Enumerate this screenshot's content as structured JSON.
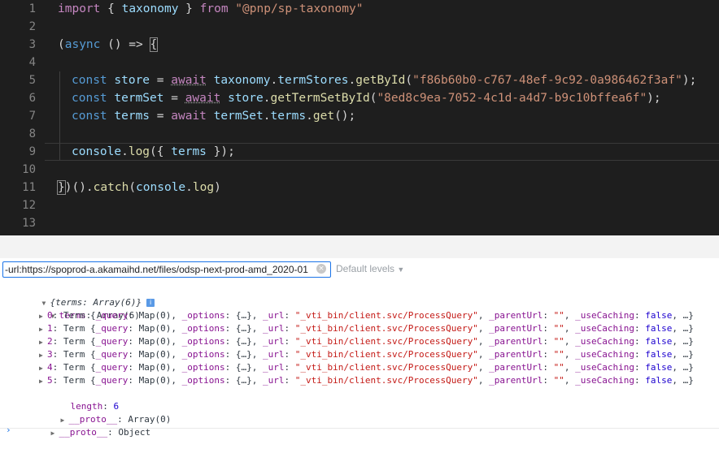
{
  "editor": {
    "line_numbers": [
      "1",
      "2",
      "3",
      "4",
      "5",
      "6",
      "7",
      "8",
      "9",
      "10",
      "11",
      "12",
      "13"
    ],
    "l1": {
      "import": "import",
      "brace_open": " { ",
      "name": "taxonomy",
      "brace_close": " } ",
      "from": "from",
      "space": " ",
      "module": "\"@pnp/sp-taxonomy\""
    },
    "l3": {
      "open": "(",
      "async": "async",
      "rest": " () => ",
      "brace": "{"
    },
    "l5": {
      "const": "const",
      "var": " store",
      "eq": " = ",
      "await": "await",
      "obj": " taxonomy",
      "dot1": ".",
      "prop": "termStores",
      "dot2": ".",
      "fn": "getById",
      "p1": "(",
      "arg": "\"f86b60b0-c767-48ef-9c92-0a986462f3af\"",
      "p2": ");"
    },
    "l6": {
      "const": "const",
      "var": " termSet",
      "eq": " = ",
      "await": "await",
      "obj": " store",
      "dot1": ".",
      "fn": "getTermSetById",
      "p1": "(",
      "arg": "\"8ed8c9ea-7052-4c1d-a4d7-b9c10bffea6f\"",
      "p2": ");"
    },
    "l7": {
      "const": "const",
      "var": " terms",
      "eq": " = ",
      "await": "await",
      "obj": " termSet",
      "dot1": ".",
      "prop": "terms",
      "dot2": ".",
      "fn": "get",
      "p": "();"
    },
    "l9": {
      "obj": "console",
      "dot": ".",
      "fn": "log",
      "rest": "({ ",
      "arg": "terms",
      "end": " });"
    },
    "l11": {
      "brace": "}",
      "rest": ")().",
      "catch": "catch",
      "p1": "(",
      "obj": "console",
      "dot": ".",
      "fn": "log",
      "p2": ")"
    }
  },
  "console": {
    "filter_value": "-url:https://spoprod-a.akamaihd.net/files/odsp-next-prod-amd_2020-01",
    "clear_icon_glyph": "×",
    "levels_label": "Default levels",
    "levels_arrow": "▼",
    "root": "{terms: Array(6)}",
    "info_glyph": "i",
    "terms_key": "terms",
    "terms_val": "Array(6)",
    "items": [
      {
        "idx": "0",
        "term": "Term {",
        "query_key": "_query",
        "query_val": "Map(0)",
        "options_key": "_options",
        "options_val": "{…}",
        "url_key": "_url",
        "url_val": "\"_vti_bin/client.svc/ProcessQuery\"",
        "parent_key": "_parentUrl",
        "parent_val": "\"\"",
        "cache_key": "_useCaching",
        "cache_val": "false",
        "ellipsis": "…}"
      },
      {
        "idx": "1",
        "term": "Term {",
        "query_key": "_query",
        "query_val": "Map(0)",
        "options_key": "_options",
        "options_val": "{…}",
        "url_key": "_url",
        "url_val": "\"_vti_bin/client.svc/ProcessQuery\"",
        "parent_key": "_parentUrl",
        "parent_val": "\"\"",
        "cache_key": "_useCaching",
        "cache_val": "false",
        "ellipsis": "…}"
      },
      {
        "idx": "2",
        "term": "Term {",
        "query_key": "_query",
        "query_val": "Map(0)",
        "options_key": "_options",
        "options_val": "{…}",
        "url_key": "_url",
        "url_val": "\"_vti_bin/client.svc/ProcessQuery\"",
        "parent_key": "_parentUrl",
        "parent_val": "\"\"",
        "cache_key": "_useCaching",
        "cache_val": "false",
        "ellipsis": "…}"
      },
      {
        "idx": "3",
        "term": "Term {",
        "query_key": "_query",
        "query_val": "Map(0)",
        "options_key": "_options",
        "options_val": "{…}",
        "url_key": "_url",
        "url_val": "\"_vti_bin/client.svc/ProcessQuery\"",
        "parent_key": "_parentUrl",
        "parent_val": "\"\"",
        "cache_key": "_useCaching",
        "cache_val": "false",
        "ellipsis": "…}"
      },
      {
        "idx": "4",
        "term": "Term {",
        "query_key": "_query",
        "query_val": "Map(0)",
        "options_key": "_options",
        "options_val": "{…}",
        "url_key": "_url",
        "url_val": "\"_vti_bin/client.svc/ProcessQuery\"",
        "parent_key": "_parentUrl",
        "parent_val": "\"\"",
        "cache_key": "_useCaching",
        "cache_val": "false",
        "ellipsis": "…}"
      },
      {
        "idx": "5",
        "term": "Term {",
        "query_key": "_query",
        "query_val": "Map(0)",
        "options_key": "_options",
        "options_val": "{…}",
        "url_key": "_url",
        "url_val": "\"_vti_bin/client.svc/ProcessQuery\"",
        "parent_key": "_parentUrl",
        "parent_val": "\"\"",
        "cache_key": "_useCaching",
        "cache_val": "false",
        "ellipsis": "…}"
      }
    ],
    "length_key": "length",
    "length_val": "6",
    "proto_key": "__proto__",
    "proto_array_val": "Array(0)",
    "proto_object_val": "Object",
    "prompt_glyph": "›"
  },
  "colors": {
    "editor_bg": "#1e1e1e",
    "keyword": "#569cd6",
    "control": "#c586c0",
    "string": "#ce9178",
    "function": "#dcdcaa",
    "variable": "#9cdcfe",
    "console_key": "#881391",
    "console_string": "#c41a16",
    "console_number": "#1c00cf"
  },
  "icons": {
    "expand": "triangle-down-icon",
    "collapsed": "triangle-right-icon",
    "info": "info-icon",
    "clear": "clear-circle-icon"
  }
}
